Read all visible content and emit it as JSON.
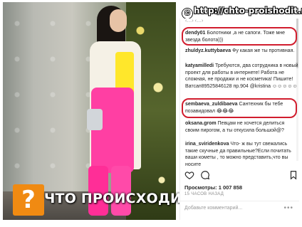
{
  "watermark": {
    "symbol": "©",
    "url": "http://chto-proishodit.ru"
  },
  "banner": {
    "badge": "?",
    "text": "ЧТО ПРОИСХОДИТ?"
  },
  "comments_panel": {
    "top_fragment": "‹…› ‹…›",
    "comments": [
      {
        "user": "dendy01",
        "text": " Болотники ,а не сапоги. Тоже мне звезда болота)))"
      },
      {
        "user": "zhuldyz.kuttybaeva",
        "text": " Фу какая же ты противная."
      },
      {
        "user": "katyamilledi",
        "text": " Требуются, два сотрудника в новый проект для работы в интернете! Работа не сложная, не продажи и не косметика! Пишите! Ватсап89525846128 пр.904 @kristina ☺☺☺☺☺"
      },
      {
        "user": "sembaeva_zuldibaeva",
        "text": " Сантехник бы тебе позавидовал 😂😂😂"
      },
      {
        "user": "oksana.grom",
        "text": " Певцам не хочется делиться своим пирогом, а ты откусила большой@?"
      },
      {
        "user": "irina_sviridenkova",
        "text": " Что- ж вы тут свежались такие скучные да правильные?Если почитать ваши кометы , то можно представить,что вы носите"
      }
    ],
    "views_label": "Просмотры: 1 007 858",
    "time_label": "15 ЧАСОВ НАЗАД",
    "add_comment_placeholder": "Добавьте комментарий...",
    "more_dots": "•••"
  },
  "colors": {
    "highlight": "#d11d2e",
    "badge": "#f08a12",
    "pants": "#ff3fa3"
  },
  "icons": [
    "heart-icon",
    "comment-icon",
    "bookmark-icon"
  ]
}
